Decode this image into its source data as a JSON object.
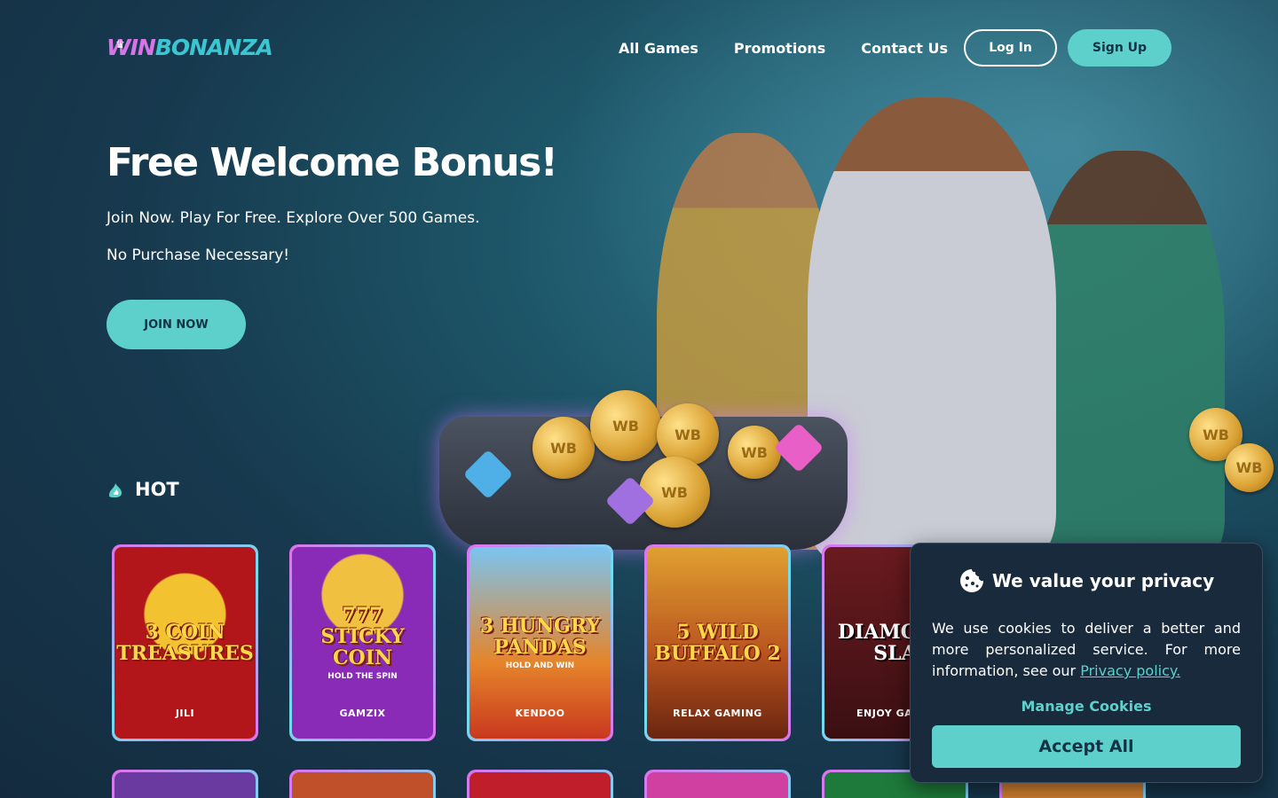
{
  "brand": {
    "logo_win": "WIN",
    "logo_bonanza": "BONANZA"
  },
  "nav": {
    "items": [
      "All Games",
      "Promotions",
      "Contact Us"
    ]
  },
  "header": {
    "login_label": "Log In",
    "signup_label": "Sign Up"
  },
  "hero": {
    "title": "Free Welcome Bonus!",
    "subtitle": "Join Now. Play For Free. Explore Over 500 Games.",
    "subtitle2": "No Purchase Necessary!",
    "join_label": "JOIN NOW",
    "coin_mark": "WB"
  },
  "section": {
    "hot_label": "HOT"
  },
  "games": [
    {
      "title": "3 COIN TREASURES",
      "provider": "JILI",
      "bg": "#b3161a"
    },
    {
      "title": "777 STICKY COIN",
      "sub": "HOLD THE SPIN",
      "provider": "GAMZIX",
      "bg": "#8a2bb8"
    },
    {
      "title": "3 HUNGRY PANDAS",
      "sub": "HOLD AND WIN",
      "provider": "KENDOO",
      "bg": "#e5852b"
    },
    {
      "title": "5 WILD BUFFALO 2",
      "provider": "RELAX GAMING",
      "bg": "#b9551f"
    },
    {
      "title": "DIAMOND SLA",
      "provider": "ENJOY GA",
      "bg": "#3a0f12"
    }
  ],
  "colors": {
    "accent": "#5dd0cc",
    "panel": "#192a3d",
    "logo_pink": "#d775e8",
    "logo_teal": "#3cc6d2"
  },
  "cookie": {
    "title": "We value your privacy",
    "text": "We use cookies to deliver a better and more personalized service. For more information, see our",
    "link": "Privacy policy.",
    "manage_label": "Manage Cookies",
    "accept_label": "Accept All"
  }
}
